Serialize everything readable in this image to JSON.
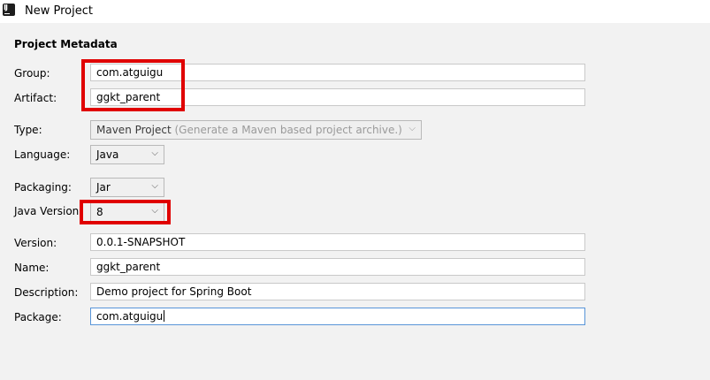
{
  "window": {
    "title": "New Project",
    "icon": "intellij-idea-icon",
    "icon_text": "IJ"
  },
  "section": {
    "title": "Project Metadata"
  },
  "fields": {
    "group": {
      "label": "Group:",
      "value": "com.atguigu"
    },
    "artifact": {
      "label": "Artifact:",
      "value": "ggkt_parent"
    },
    "type": {
      "label": "Type:",
      "value": "Maven Project",
      "hint": "(Generate a Maven based project archive.)"
    },
    "language": {
      "label": "Language:",
      "value": "Java"
    },
    "packaging": {
      "label": "Packaging:",
      "value": "Jar"
    },
    "java_version": {
      "label": "Java Version",
      "value": "8"
    },
    "version": {
      "label": "Version:",
      "value": "0.0.1-SNAPSHOT"
    },
    "name": {
      "label": "Name:",
      "value": "ggkt_parent"
    },
    "description": {
      "label": "Description:",
      "value": "Demo project for Spring Boot"
    },
    "package": {
      "label": "Package:",
      "value": "com.atguigu"
    }
  },
  "colors": {
    "highlight": "#e00000",
    "focus_border": "#5895d8",
    "background": "#f2f2f2"
  }
}
